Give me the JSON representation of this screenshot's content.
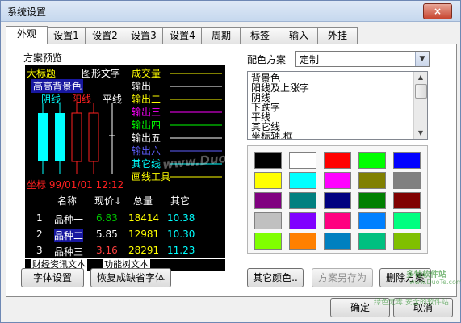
{
  "window": {
    "title": "系统设置",
    "close": "×"
  },
  "tabs": [
    {
      "label": "外观"
    },
    {
      "label": "设置1"
    },
    {
      "label": "设置2"
    },
    {
      "label": "设置3"
    },
    {
      "label": "设置4"
    },
    {
      "label": "周期"
    },
    {
      "label": "标签"
    },
    {
      "label": "输入"
    },
    {
      "label": "外挂"
    }
  ],
  "preview_label": "方案预览",
  "preview": {
    "big_title": "大标题",
    "graph_text": "图形文字",
    "high_bg": "高高背景色",
    "yin": "阴线",
    "yang": "阳线",
    "flat": "平线",
    "coords": "坐标 99/01/01 12:12",
    "trade": "成交量",
    "outputs": [
      "输出一",
      "输出二",
      "输出三",
      "输出四",
      "输出五",
      "输出六"
    ],
    "other_line": "其它线",
    "draw_tool": "画线工具",
    "output_colors": [
      "#ffffff",
      "#ffff00",
      "#ff00ff",
      "#00ff00",
      "#ffffff",
      "#6060ff"
    ],
    "table_headers": [
      "名称",
      "现价↓",
      "总量",
      "其它"
    ],
    "rows": [
      {
        "idx": "1",
        "name": "品种一",
        "price": "6.83",
        "vol": "18414",
        "other": "10.38",
        "price_color": "#00c000"
      },
      {
        "idx": "2",
        "name": "品种二",
        "price": "5.85",
        "vol": "12981",
        "other": "10.30",
        "price_color": "#ffffff"
      },
      {
        "idx": "3",
        "name": "品种三",
        "price": "3.16",
        "vol": "28291",
        "other": "11.23",
        "price_color": "#ff4040"
      }
    ],
    "news_text": "财经资讯文本",
    "tree_text": "功能树文本",
    "watermark": "www.Duote.com"
  },
  "scheme_label": "配色方案",
  "scheme_value": "定制",
  "list_items": [
    "背景色",
    "阳线及上涨字",
    "阴线",
    "下跌字",
    "平线",
    "其它线",
    "坐标轴,框"
  ],
  "palette": [
    "#000000",
    "#ffffff",
    "#ff0000",
    "#00ff00",
    "#0000ff",
    "#ffff00",
    "#00ffff",
    "#ff00ff",
    "#808000",
    "#808080",
    "#800080",
    "#008080",
    "#000080",
    "#008000",
    "#800000",
    "#c0c0c0",
    "#8000ff",
    "#ff0080",
    "#0080ff",
    "#00ff80",
    "#80ff00",
    "#ff8000",
    "#0080c0",
    "#00c080",
    "#80c000"
  ],
  "buttons": {
    "font_settings": "字体设置",
    "restore_font": "恢复成缺省字体",
    "other_color": "其它颜色..",
    "save_scheme": "方案另存为",
    "delete_scheme": "删除方案",
    "ok": "确定",
    "cancel": "取消"
  },
  "corner_watermark": {
    "top": "多特软件站",
    "url": "www.DuoTe.com",
    "bottom": "绿色无毒 安全的软件站"
  }
}
